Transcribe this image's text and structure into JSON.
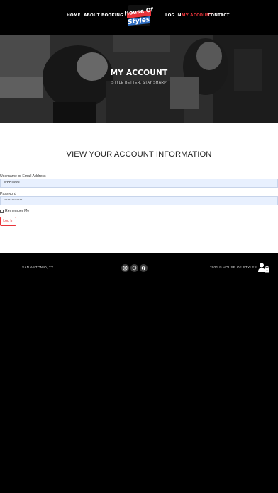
{
  "nav": {
    "left": [
      "HOME",
      "ABOUT",
      "BOOKING"
    ],
    "right": [
      "LOG IN",
      "MY ACCOUNT",
      "CONTACT"
    ],
    "active": "MY ACCOUNT",
    "logo_line1": "House Of",
    "logo_line2": "Styles"
  },
  "hero": {
    "title": "MY ACCOUNT",
    "subtitle": "STYLE BETTER, STAY SHARP"
  },
  "main": {
    "heading": "VIEW YOUR ACCOUNT INFORMATION",
    "username_label": "Username or Email Address",
    "username_value": "eroc1999",
    "password_label": "Password",
    "password_value": "••••••••••••••",
    "remember_label": "Remember Me",
    "login_button": "Log In"
  },
  "footer": {
    "location": "SAN ANTONIO, TX",
    "copyright": "2021 © HOUSE OF STYLES",
    "social": [
      "instagram-icon",
      "whatsapp-icon",
      "facebook-icon"
    ],
    "account_icon": "user-lock-icon"
  },
  "colors": {
    "accent": "#e8343a",
    "input_bg": "#e8f0fe",
    "header_bg": "#000000"
  }
}
